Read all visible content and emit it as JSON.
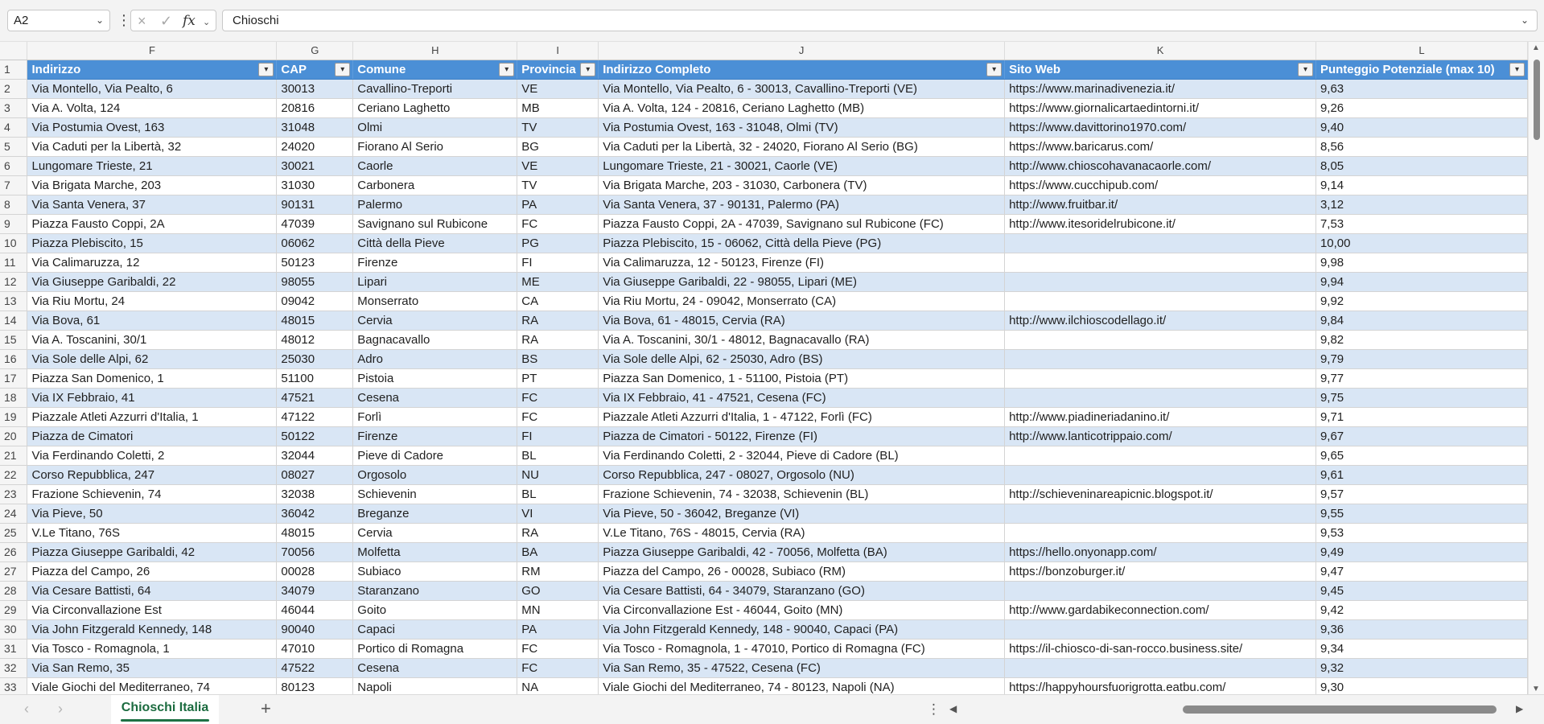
{
  "formula_bar": {
    "name_box": "A2",
    "cancel_icon": "×",
    "confirm_icon": "✓",
    "fx_label": "fx",
    "formula_value": "Chioschi"
  },
  "columns": [
    "F",
    "G",
    "H",
    "I",
    "J",
    "K",
    "L"
  ],
  "header_row": {
    "row_number": "1",
    "cells": [
      "Indirizzo",
      "CAP",
      "Comune",
      "Provincia",
      "Indirizzo Completo",
      "Sito Web",
      "Punteggio Potenziale (max 10)"
    ]
  },
  "rows": [
    {
      "n": "2",
      "cells": [
        "Via Montello, Via Pealto, 6",
        "30013",
        "Cavallino-Treporti",
        "VE",
        "Via Montello, Via Pealto, 6 - 30013, Cavallino-Treporti (VE)",
        "https://www.marinadivenezia.it/",
        "9,63"
      ]
    },
    {
      "n": "3",
      "cells": [
        "Via A. Volta, 124",
        "20816",
        "Ceriano Laghetto",
        "MB",
        "Via A. Volta, 124 - 20816, Ceriano Laghetto (MB)",
        "https://www.giornalicartaedintorni.it/",
        "9,26"
      ]
    },
    {
      "n": "4",
      "cells": [
        "Via Postumia Ovest, 163",
        "31048",
        "Olmi",
        "TV",
        "Via Postumia Ovest, 163 - 31048, Olmi (TV)",
        "https://www.davittorino1970.com/",
        "9,40"
      ]
    },
    {
      "n": "5",
      "cells": [
        "Via Caduti per la Libertà, 32",
        "24020",
        "Fiorano Al Serio",
        "BG",
        "Via Caduti per la Libertà, 32 - 24020, Fiorano Al Serio (BG)",
        "https://www.baricarus.com/",
        "8,56"
      ]
    },
    {
      "n": "6",
      "cells": [
        "Lungomare Trieste, 21",
        "30021",
        "Caorle",
        "VE",
        "Lungomare Trieste, 21 - 30021, Caorle (VE)",
        "http://www.chioscohavanacaorle.com/",
        "8,05"
      ]
    },
    {
      "n": "7",
      "cells": [
        "Via Brigata Marche, 203",
        "31030",
        "Carbonera",
        "TV",
        "Via Brigata Marche, 203 - 31030, Carbonera (TV)",
        "https://www.cucchipub.com/",
        "9,14"
      ]
    },
    {
      "n": "8",
      "cells": [
        "Via Santa Venera, 37",
        "90131",
        "Palermo",
        "PA",
        "Via Santa Venera, 37 - 90131, Palermo (PA)",
        "http://www.fruitbar.it/",
        "3,12"
      ]
    },
    {
      "n": "9",
      "cells": [
        "Piazza Fausto Coppi, 2A",
        "47039",
        "Savignano sul Rubicone",
        "FC",
        "Piazza Fausto Coppi, 2A - 47039, Savignano sul Rubicone (FC)",
        "http://www.itesoridelrubicone.it/",
        "7,53"
      ]
    },
    {
      "n": "10",
      "cells": [
        "Piazza Plebiscito, 15",
        "06062",
        "Città della Pieve",
        "PG",
        "Piazza Plebiscito, 15 - 06062, Città della Pieve (PG)",
        "",
        "10,00"
      ]
    },
    {
      "n": "11",
      "cells": [
        "Via Calimaruzza, 12",
        "50123",
        "Firenze",
        "FI",
        "Via Calimaruzza, 12 - 50123, Firenze (FI)",
        "",
        "9,98"
      ]
    },
    {
      "n": "12",
      "cells": [
        "Via Giuseppe Garibaldi, 22",
        "98055",
        "Lipari",
        "ME",
        "Via Giuseppe Garibaldi, 22 - 98055, Lipari (ME)",
        "",
        "9,94"
      ]
    },
    {
      "n": "13",
      "cells": [
        "Via Riu Mortu, 24",
        "09042",
        "Monserrato",
        "CA",
        "Via Riu Mortu, 24 - 09042, Monserrato (CA)",
        "",
        "9,92"
      ]
    },
    {
      "n": "14",
      "cells": [
        "Via Bova, 61",
        "48015",
        "Cervia",
        "RA",
        "Via Bova, 61 - 48015, Cervia (RA)",
        "http://www.ilchioscodellago.it/",
        "9,84"
      ]
    },
    {
      "n": "15",
      "cells": [
        "Via A. Toscanini, 30/1",
        "48012",
        "Bagnacavallo",
        "RA",
        "Via A. Toscanini, 30/1 - 48012, Bagnacavallo (RA)",
        "",
        "9,82"
      ]
    },
    {
      "n": "16",
      "cells": [
        "Via Sole delle Alpi, 62",
        "25030",
        "Adro",
        "BS",
        "Via Sole delle Alpi, 62 - 25030, Adro (BS)",
        "",
        "9,79"
      ]
    },
    {
      "n": "17",
      "cells": [
        "Piazza San Domenico, 1",
        "51100",
        "Pistoia",
        "PT",
        "Piazza San Domenico, 1 - 51100, Pistoia (PT)",
        "",
        "9,77"
      ]
    },
    {
      "n": "18",
      "cells": [
        "Via IX Febbraio, 41",
        "47521",
        "Cesena",
        "FC",
        "Via IX Febbraio, 41 - 47521, Cesena (FC)",
        "",
        "9,75"
      ]
    },
    {
      "n": "19",
      "cells": [
        "Piazzale Atleti Azzurri d'Italia, 1",
        "47122",
        "Forlì",
        "FC",
        "Piazzale Atleti Azzurri d'Italia, 1 - 47122, Forlì (FC)",
        "http://www.piadineriadanino.it/",
        "9,71"
      ]
    },
    {
      "n": "20",
      "cells": [
        "Piazza de Cimatori",
        "50122",
        "Firenze",
        "FI",
        "Piazza de Cimatori - 50122, Firenze (FI)",
        "http://www.lanticotrippaio.com/",
        "9,67"
      ]
    },
    {
      "n": "21",
      "cells": [
        "Via Ferdinando Coletti, 2",
        "32044",
        "Pieve di Cadore",
        "BL",
        "Via Ferdinando Coletti, 2 - 32044, Pieve di Cadore (BL)",
        "",
        "9,65"
      ]
    },
    {
      "n": "22",
      "cells": [
        "Corso Repubblica, 247",
        "08027",
        "Orgosolo",
        "NU",
        "Corso Repubblica, 247 - 08027, Orgosolo (NU)",
        "",
        "9,61"
      ]
    },
    {
      "n": "23",
      "cells": [
        "Frazione Schievenin, 74",
        "32038",
        "Schievenin",
        "BL",
        "Frazione Schievenin, 74 - 32038, Schievenin (BL)",
        "http://schieveninareapicnic.blogspot.it/",
        "9,57"
      ]
    },
    {
      "n": "24",
      "cells": [
        "Via Pieve, 50",
        "36042",
        "Breganze",
        "VI",
        "Via Pieve, 50 - 36042, Breganze (VI)",
        "",
        "9,55"
      ]
    },
    {
      "n": "25",
      "cells": [
        "V.Le Titano, 76S",
        "48015",
        "Cervia",
        "RA",
        "V.Le Titano, 76S - 48015, Cervia (RA)",
        "",
        "9,53"
      ]
    },
    {
      "n": "26",
      "cells": [
        "Piazza Giuseppe Garibaldi, 42",
        "70056",
        "Molfetta",
        "BA",
        "Piazza Giuseppe Garibaldi, 42 - 70056, Molfetta (BA)",
        "https://hello.onyonapp.com/",
        "9,49"
      ]
    },
    {
      "n": "27",
      "cells": [
        "Piazza del Campo, 26",
        "00028",
        "Subiaco",
        "RM",
        "Piazza del Campo, 26 - 00028, Subiaco (RM)",
        "https://bonzoburger.it/",
        "9,47"
      ]
    },
    {
      "n": "28",
      "cells": [
        "Via Cesare Battisti, 64",
        "34079",
        "Staranzano",
        "GO",
        "Via Cesare Battisti, 64 - 34079, Staranzano (GO)",
        "",
        "9,45"
      ]
    },
    {
      "n": "29",
      "cells": [
        "Via Circonvallazione Est",
        "46044",
        "Goito",
        "MN",
        "Via Circonvallazione Est - 46044, Goito (MN)",
        "http://www.gardabikeconnection.com/",
        "9,42"
      ]
    },
    {
      "n": "30",
      "cells": [
        "Via John Fitzgerald Kennedy, 148",
        "90040",
        "Capaci",
        "PA",
        "Via John Fitzgerald Kennedy, 148 - 90040, Capaci (PA)",
        "",
        "9,36"
      ]
    },
    {
      "n": "31",
      "cells": [
        "Via Tosco - Romagnola, 1",
        "47010",
        "Portico di Romagna",
        "FC",
        "Via Tosco - Romagnola, 1 - 47010, Portico di Romagna (FC)",
        "https://il-chiosco-di-san-rocco.business.site/",
        "9,34"
      ]
    },
    {
      "n": "32",
      "cells": [
        "Via San Remo, 35",
        "47522",
        "Cesena",
        "FC",
        "Via San Remo, 35 - 47522, Cesena (FC)",
        "",
        "9,32"
      ]
    },
    {
      "n": "33",
      "cells": [
        "Viale Giochi del Mediterraneo, 74",
        "80123",
        "Napoli",
        "NA",
        "Viale Giochi del Mediterraneo, 74 - 80123, Napoli (NA)",
        "https://happyhoursfuorigrotta.eatbu.com/",
        "9,30"
      ]
    }
  ],
  "sheet_tabs": {
    "active_tab": "Chioschi Italia",
    "add_label": "+"
  },
  "colors": {
    "header_fill": "#4b8fd6",
    "band_fill": "#d9e6f5",
    "accent": "#1e7145"
  },
  "icons": {
    "name_box_dropdown": "chevron-down-icon",
    "cancel": "close-icon",
    "confirm": "check-icon",
    "insert_function": "fx-icon",
    "filter": "filter-dropdown-icon",
    "add_sheet": "plus-icon"
  }
}
